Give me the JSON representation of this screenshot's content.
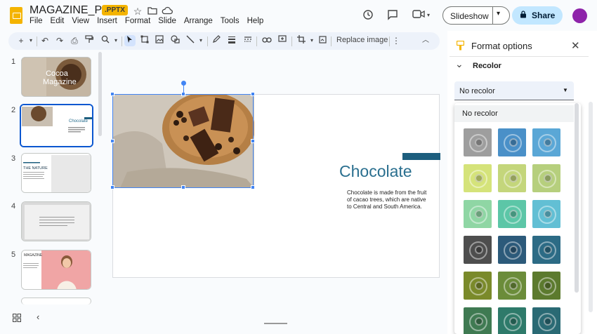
{
  "header": {
    "doc_title": "MAGAZINE_PPTX",
    "badge": ".PPTX",
    "menu": [
      "File",
      "Edit",
      "View",
      "Insert",
      "Format",
      "Slide",
      "Arrange",
      "Tools",
      "Help"
    ],
    "slideshow_label": "Slideshow",
    "share_label": "Share",
    "colors": {
      "brand": "#f4b400",
      "share": "#c2e7ff",
      "avatar": "#8e24aa"
    }
  },
  "toolbar": {
    "replace_image_label": "Replace image"
  },
  "filmstrip": {
    "slides": [
      {
        "number": "1",
        "title": "Cocoa Magazine"
      },
      {
        "number": "2",
        "title": "Chocolate"
      },
      {
        "number": "3",
        "title": "THE NATURE"
      },
      {
        "number": "4",
        "title": ""
      },
      {
        "number": "5",
        "title": "MAGAZINE"
      }
    ],
    "selected": "2"
  },
  "slide": {
    "title": "Chocolate",
    "body": "Chocolate is made from the fruit of cacao trees, which are native to Central and South America.",
    "colors": {
      "title": "#2a6f8f",
      "accent": "#1d5e7e"
    }
  },
  "panel": {
    "title": "Format options",
    "section": "Recolor",
    "selected_value": "No recolor",
    "options_first": "No recolor",
    "swatches": [
      [
        "#9e9e9e",
        "#4a90c8",
        "#5aa7d6"
      ],
      [
        "#d5e37a",
        "#c4d67b",
        "#b6cf7d"
      ],
      [
        "#8fd6a4",
        "#5cc6a7",
        "#62bfd4"
      ],
      [
        "#4e4e4e",
        "#2c5a7a",
        "#2c6b85"
      ],
      [
        "#7a8a2a",
        "#6b8c3a",
        "#5c7a2e"
      ],
      [
        "#3f7a52",
        "#2e7a6a",
        "#2a6a74"
      ]
    ]
  }
}
